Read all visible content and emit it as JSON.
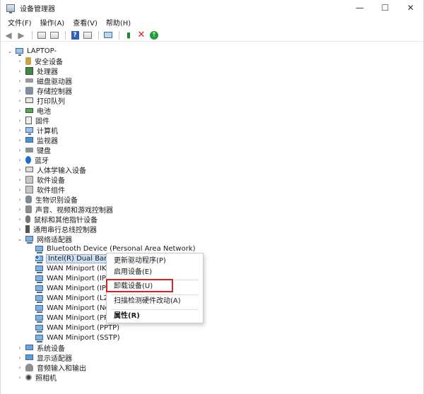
{
  "window": {
    "title": "设备管理器",
    "controls": {
      "minimize": "—",
      "maximize": "☐",
      "close": "✕"
    }
  },
  "menu": [
    "文件(F)",
    "操作(A)",
    "查看(V)",
    "帮助(H)"
  ],
  "toolbar": [
    "back-arrow-icon",
    "forward-arrow-icon",
    "properties-icon",
    "view-icon",
    "help-icon",
    "view-list-icon",
    "monitor-icon",
    "update-driver-icon",
    "uninstall-icon",
    "scan-hardware-icon"
  ],
  "tree": {
    "root": "LAPTOP-",
    "categories": [
      {
        "label": "安全设备",
        "icon": "security-device-icon",
        "expanded": false
      },
      {
        "label": "处理器",
        "icon": "processor-icon",
        "expanded": false
      },
      {
        "label": "磁盘驱动器",
        "icon": "disk-drive-icon",
        "expanded": false
      },
      {
        "label": "存储控制器",
        "icon": "storage-controller-icon",
        "expanded": false
      },
      {
        "label": "打印队列",
        "icon": "printer-icon",
        "expanded": false
      },
      {
        "label": "电池",
        "icon": "battery-icon",
        "expanded": false
      },
      {
        "label": "固件",
        "icon": "firmware-icon",
        "expanded": false
      },
      {
        "label": "计算机",
        "icon": "computer-icon",
        "expanded": false
      },
      {
        "label": "监视器",
        "icon": "monitor-icon",
        "expanded": false
      },
      {
        "label": "键盘",
        "icon": "keyboard-icon",
        "expanded": false
      },
      {
        "label": "蓝牙",
        "icon": "bluetooth-icon",
        "expanded": false
      },
      {
        "label": "人体学输入设备",
        "icon": "hid-icon",
        "expanded": false
      },
      {
        "label": "软件设备",
        "icon": "software-device-icon",
        "expanded": false
      },
      {
        "label": "软件组件",
        "icon": "software-component-icon",
        "expanded": false
      },
      {
        "label": "生物识别设备",
        "icon": "biometric-icon",
        "expanded": false
      },
      {
        "label": "声音、视频和游戏控制器",
        "icon": "sound-icon",
        "expanded": false
      },
      {
        "label": "鼠标和其他指针设备",
        "icon": "mouse-icon",
        "expanded": false
      },
      {
        "label": "通用串行总线控制器",
        "icon": "usb-icon",
        "expanded": false
      },
      {
        "label": "网络适配器",
        "icon": "network-adapter-icon",
        "expanded": true
      }
    ],
    "network_children": [
      "Bluetooth Device (Personal Area Network)",
      "Intel(R) Dual Band Wireless-AC 3165",
      "WAN Miniport (IKEv2)",
      "WAN Miniport (IP)",
      "WAN Miniport (IPv6)",
      "WAN Miniport (L2TP)",
      "WAN Miniport (Network Monitor)",
      "WAN Miniport (PPPOE)",
      "WAN Miniport (PPTP)",
      "WAN Miniport (SSTP)"
    ],
    "after": [
      {
        "label": "系统设备",
        "icon": "system-device-icon"
      },
      {
        "label": "显示适配器",
        "icon": "display-adapter-icon"
      },
      {
        "label": "音频输入和输出",
        "icon": "audio-io-icon"
      },
      {
        "label": "照相机",
        "icon": "camera-icon"
      }
    ]
  },
  "context_menu": {
    "items": [
      "更新驱动程序(P)",
      "启用设备(E)",
      "卸载设备(U)",
      "扫描检测硬件改动(A)",
      "属性(R)"
    ],
    "highlighted": "卸载设备(U)",
    "highlight_color": "#e02020"
  }
}
